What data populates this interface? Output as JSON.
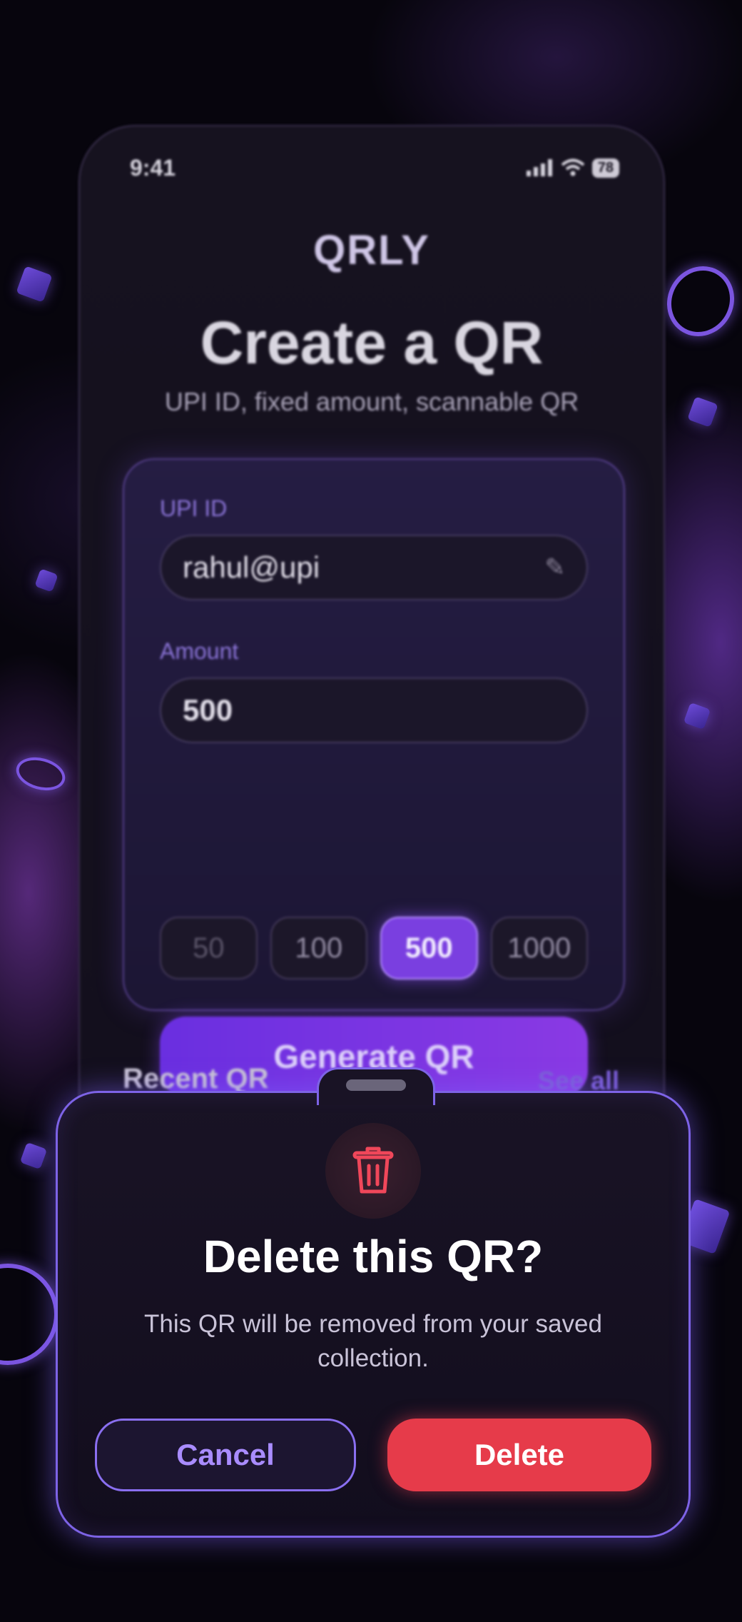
{
  "status_bar": {
    "time": "9:41",
    "battery": "78"
  },
  "header": {
    "logo": "QRLY",
    "title": "Create a QR",
    "subtitle": "UPI ID, fixed amount, scannable QR"
  },
  "form": {
    "upi_label": "UPI ID",
    "upi_value": "rahul@upi",
    "amount_label": "Amount",
    "amount_value": "500",
    "presets": [
      "50",
      "100",
      "500",
      "1000"
    ],
    "selected_preset": "500",
    "generate_label": "Generate QR"
  },
  "recent": {
    "label": "Recent QR",
    "see_all": "See all"
  },
  "dialog": {
    "title": "Delete this QR?",
    "message": "This QR will be removed from your saved collection.",
    "cancel_label": "Cancel",
    "delete_label": "Delete",
    "icon": "trash-icon"
  },
  "colors": {
    "accent": "#7a3fe0",
    "danger": "#e63b4a",
    "outline": "#8a6ff0"
  }
}
